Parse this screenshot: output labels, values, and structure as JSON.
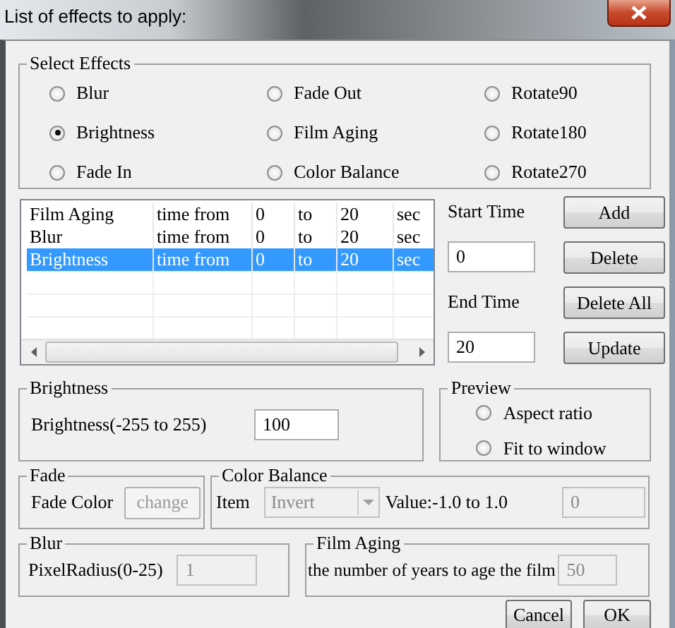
{
  "window": {
    "title": "List of effects to apply:"
  },
  "select_effects": {
    "title": "Select Effects",
    "options": [
      {
        "label": "Blur",
        "selected": false
      },
      {
        "label": "Fade Out",
        "selected": false
      },
      {
        "label": "Rotate90",
        "selected": false
      },
      {
        "label": "Brightness",
        "selected": true
      },
      {
        "label": "Film Aging",
        "selected": false
      },
      {
        "label": "Rotate180",
        "selected": false
      },
      {
        "label": "Fade In",
        "selected": false
      },
      {
        "label": "Color Balance",
        "selected": false
      },
      {
        "label": "Rotate270",
        "selected": false
      }
    ]
  },
  "effects_table": {
    "rows": [
      {
        "cells": [
          "Film Aging",
          "time from",
          "0",
          "to",
          "20",
          "sec"
        ],
        "selected": false
      },
      {
        "cells": [
          "Blur",
          "time from",
          "0",
          "to",
          "20",
          "sec"
        ],
        "selected": false
      },
      {
        "cells": [
          "Brightness",
          "time from",
          "0",
          "to",
          "20",
          "sec"
        ],
        "selected": true
      }
    ]
  },
  "start_time": {
    "label": "Start Time",
    "field": {
      "value": "0",
      "disabled": false
    }
  },
  "end_time": {
    "label": "End Time",
    "field": {
      "value": "20",
      "disabled": false
    }
  },
  "list_buttons": [
    {
      "label": "Add"
    },
    {
      "label": "Delete"
    },
    {
      "label": "Delete All"
    },
    {
      "label": "Update"
    }
  ],
  "brightness": {
    "title": "Brightness",
    "label": "Brightness(-255 to 255)",
    "field": {
      "value": "100",
      "disabled": false
    }
  },
  "preview": {
    "title": "Preview",
    "options": [
      {
        "label": "Aspect ratio",
        "selected": false
      },
      {
        "label": "Fit to window",
        "selected": false
      }
    ]
  },
  "fade": {
    "title": "Fade",
    "label": "Fade Color",
    "button": {
      "label": "change",
      "disabled": true
    }
  },
  "color_balance": {
    "title": "Color Balance",
    "item_label": "Item",
    "item": {
      "value": "Invert",
      "disabled": true
    },
    "value_label": "Value:-1.0 to 1.0",
    "field": {
      "value": "0",
      "disabled": true
    }
  },
  "blur": {
    "title": "Blur",
    "label": "PixelRadius(0-25)",
    "field": {
      "value": "1",
      "disabled": true
    }
  },
  "film_aging": {
    "title": "Film Aging",
    "label": "the number of years to age the film",
    "field": {
      "value": "50",
      "disabled": true
    }
  },
  "dialog_buttons": [
    {
      "label": "Cancel"
    },
    {
      "label": "OK"
    }
  ]
}
